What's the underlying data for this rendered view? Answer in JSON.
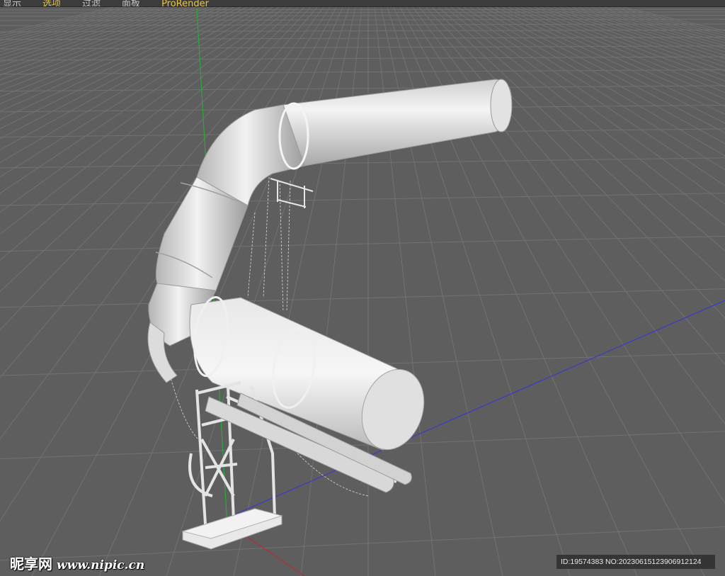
{
  "menubar": {
    "items": [
      {
        "label": "显示"
      },
      {
        "label": "选项"
      },
      {
        "label": "过滤"
      },
      {
        "label": "面板"
      },
      {
        "label": "ProRender"
      }
    ]
  },
  "watermark": {
    "site_name": "昵享网",
    "site_url": "www.nipic.cn",
    "id_text": "ID:19574383 NO:20230615123906912124"
  },
  "colors": {
    "viewport_bg": "#5e5e5e",
    "grid_line": "#6e6e6e",
    "axis_y": "#2fa83a",
    "axis_x": "#b03030",
    "axis_z": "#3a3ac8",
    "model": "#e4e4e4",
    "menu_active": "#e8c64a"
  },
  "icons": {
    "pipe_model": "pipe-rack-3d-model"
  }
}
